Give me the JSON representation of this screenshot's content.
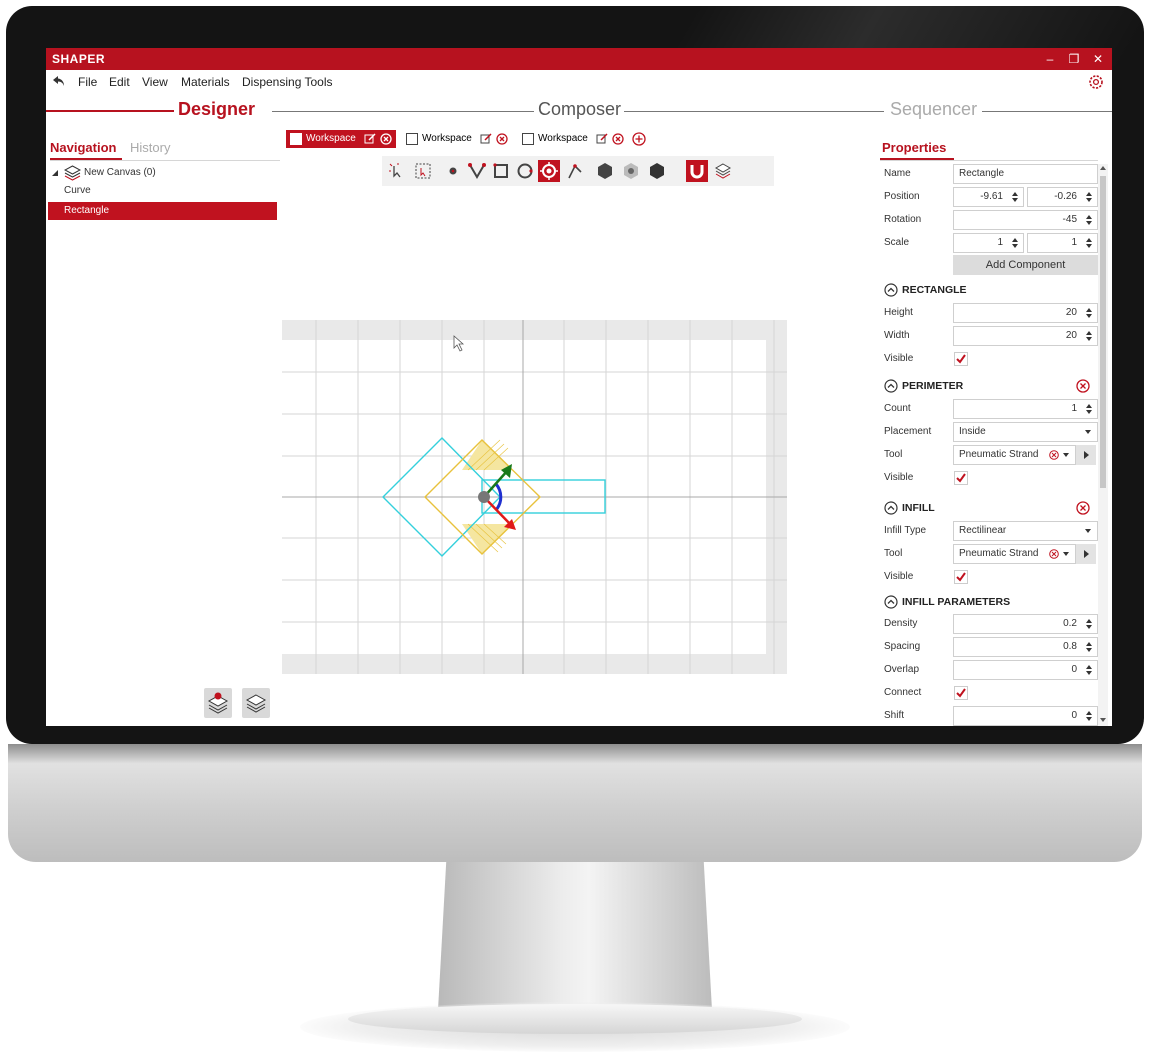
{
  "app": {
    "title": "SHAPER"
  },
  "window_controls": {
    "minimize": "–",
    "restore": "❐",
    "close": "✕"
  },
  "menu": [
    "File",
    "Edit",
    "View",
    "Materials",
    "Dispensing Tools"
  ],
  "modes": {
    "designer": "Designer",
    "composer": "Composer",
    "sequencer": "Sequencer"
  },
  "left_panel": {
    "tabs": {
      "navigation": "Navigation",
      "history": "History"
    },
    "tree": {
      "root": "New Canvas (0)",
      "children": [
        "Curve",
        "Rectangle"
      ]
    }
  },
  "workspace_tabs": [
    "Workspace",
    "Workspace",
    "Workspace"
  ],
  "colors": {
    "accent": "#b7121f",
    "shape_outline": "#34d0dc",
    "selection": "#e8c23c"
  },
  "properties": {
    "title": "Properties",
    "name_label": "Name",
    "name_value": "Rectangle",
    "position_label": "Position",
    "position_x": "-9.61",
    "position_y": "-0.26",
    "rotation_label": "Rotation",
    "rotation_value": "-45",
    "scale_label": "Scale",
    "scale_x": "1",
    "scale_y": "1",
    "add_component": "Add Component",
    "rectangle": {
      "title": "RECTANGLE",
      "height_label": "Height",
      "height": "20",
      "width_label": "Width",
      "width": "20",
      "visible_label": "Visible"
    },
    "perimeter": {
      "title": "PERIMETER",
      "count_label": "Count",
      "count": "1",
      "placement_label": "Placement",
      "placement": "Inside",
      "tool_label": "Tool",
      "tool": "Pneumatic Strand",
      "visible_label": "Visible"
    },
    "infill": {
      "title": "INFILL",
      "type_label": "Infill Type",
      "type": "Rectilinear",
      "tool_label": "Tool",
      "tool": "Pneumatic Strand",
      "visible_label": "Visible"
    },
    "infill_params": {
      "title": "INFILL PARAMETERS",
      "density_label": "Density",
      "density": "0.2",
      "spacing_label": "Spacing",
      "spacing": "0.8",
      "overlap_label": "Overlap",
      "overlap": "0",
      "connect_label": "Connect",
      "shift_label": "Shift",
      "shift": "0"
    }
  }
}
